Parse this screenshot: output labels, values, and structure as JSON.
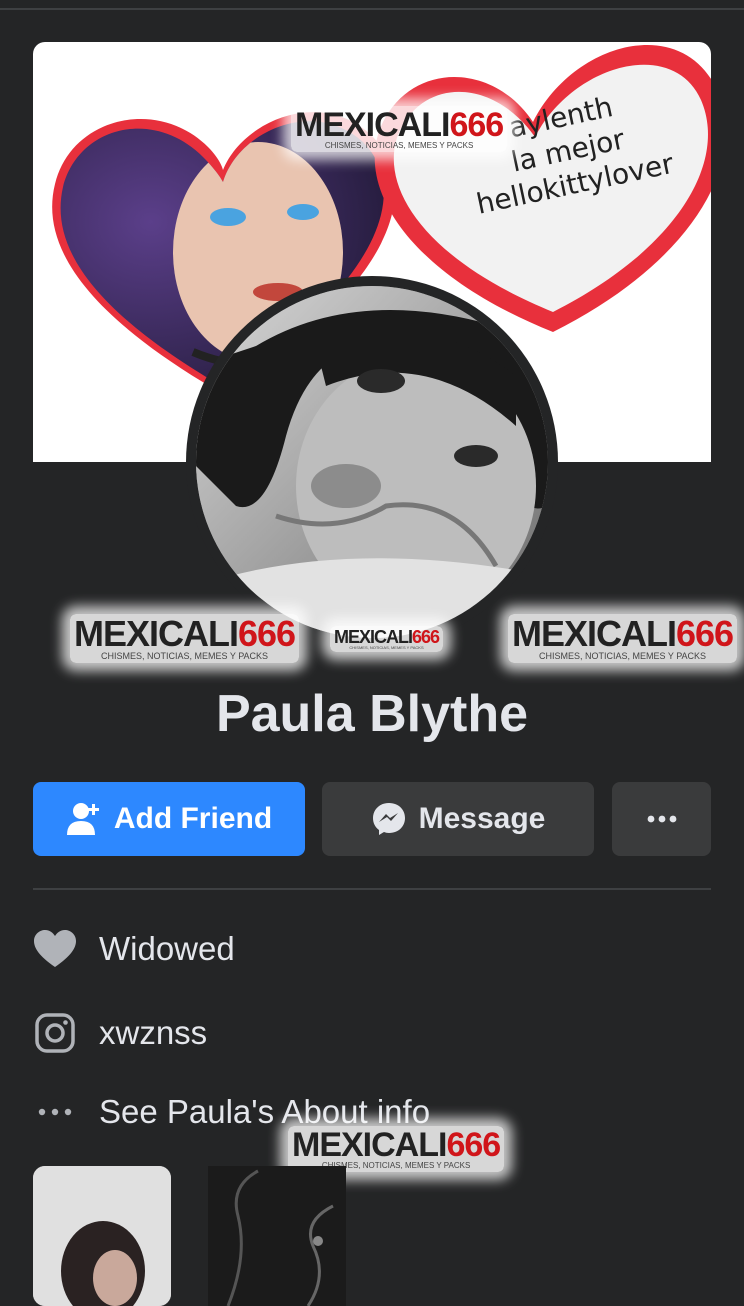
{
  "profile": {
    "name": "Paula Blythe"
  },
  "cover": {
    "heart_text": [
      "aylenth",
      "la mejor",
      "hellokittylover"
    ]
  },
  "watermark": {
    "brand_a": "MEXICALI",
    "brand_b": "666",
    "tagline": "CHISMES, NOTICIAS, MEMES Y PACKS"
  },
  "actions": {
    "add_friend": "Add Friend",
    "message": "Message",
    "more_icon": "more-dots-icon"
  },
  "info": [
    {
      "icon": "heart-icon",
      "text": "Widowed"
    },
    {
      "icon": "instagram-icon",
      "text": "xwznss"
    },
    {
      "icon": "more-dots-icon",
      "text": "See Paula's About info"
    }
  ],
  "colors": {
    "background": "#242526",
    "primary_button": "#2d88ff",
    "secondary_button": "#3a3b3c",
    "text": "#e4e6eb",
    "icon_gray": "#b0b3b8",
    "heart_red": "#e8303c"
  }
}
